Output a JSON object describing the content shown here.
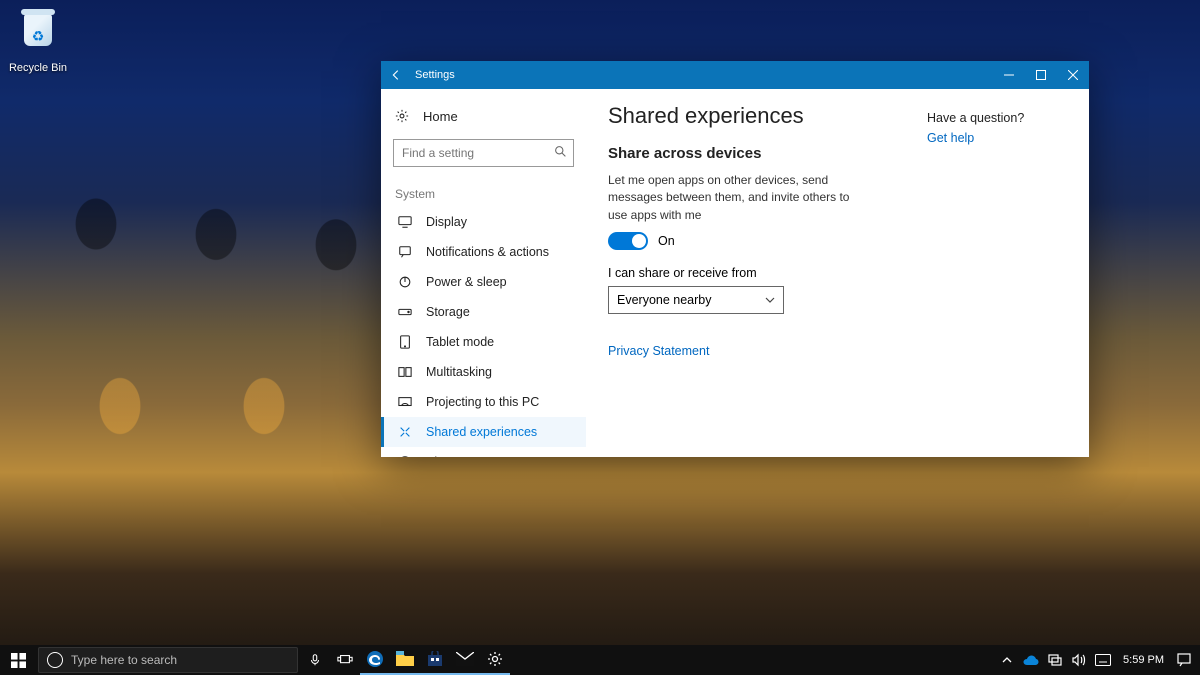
{
  "desktop": {
    "recycle_bin": "Recycle Bin"
  },
  "window": {
    "title": "Settings",
    "home": "Home",
    "search_placeholder": "Find a setting",
    "section": "System",
    "nav": [
      {
        "label": "Display"
      },
      {
        "label": "Notifications & actions"
      },
      {
        "label": "Power & sleep"
      },
      {
        "label": "Storage"
      },
      {
        "label": "Tablet mode"
      },
      {
        "label": "Multitasking"
      },
      {
        "label": "Projecting to this PC"
      },
      {
        "label": "Shared experiences"
      },
      {
        "label": "About"
      }
    ],
    "page": {
      "title": "Shared experiences",
      "section_title": "Share across devices",
      "description": "Let me open apps on other devices, send messages between them, and invite others to use apps with me",
      "toggle_state": "On",
      "dropdown_label": "I can share or receive from",
      "dropdown_value": "Everyone nearby",
      "privacy_link": "Privacy Statement"
    },
    "aside": {
      "question": "Have a question?",
      "help": "Get help"
    }
  },
  "taskbar": {
    "search_placeholder": "Type here to search",
    "clock": "5:59 PM"
  }
}
